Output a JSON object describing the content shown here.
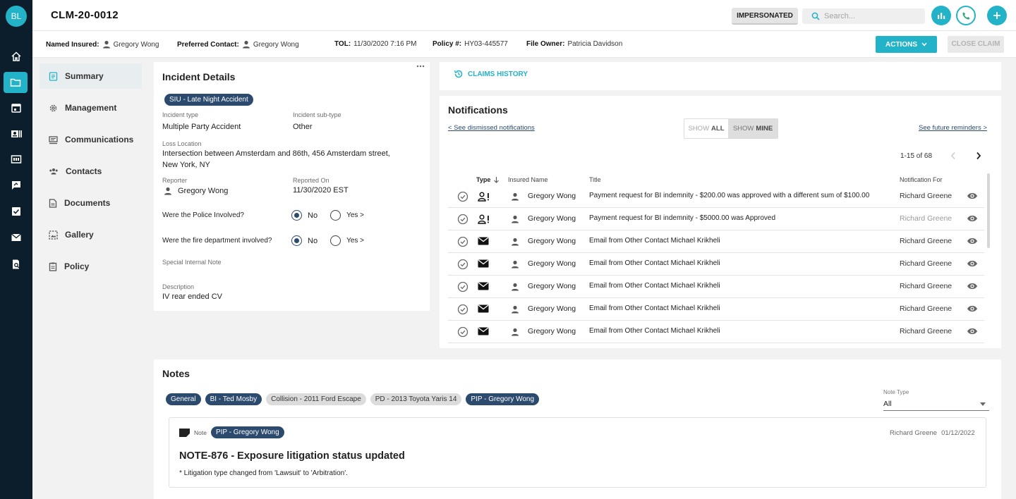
{
  "user": {
    "initials": "BL"
  },
  "rail": {
    "icons": [
      "home-icon",
      "folder-icon",
      "calendar-icon",
      "id-card-icon",
      "numbers-icon",
      "chat-icon",
      "checklist-icon",
      "mail-icon",
      "document-search-icon"
    ]
  },
  "header": {
    "claim_number": "CLM-20-0012",
    "impersonated_label": "IMPERSONATED",
    "search_placeholder": "Search..."
  },
  "info": {
    "named_insured_label": "Named Insured:",
    "named_insured": "Gregory Wong",
    "preferred_contact_label": "Preferred Contact:",
    "preferred_contact": "Gregory Wong",
    "tol_label": "TOL:",
    "tol": "11/30/2020 7:16 PM",
    "policy_label": "Policy #:",
    "policy": "HY03-445577",
    "file_owner_label": "File Owner:",
    "file_owner": "Patricia Davidson",
    "actions_label": "ACTIONS",
    "close_claim_label": "CLOSE CLAIM"
  },
  "sidenav": [
    {
      "label": "Summary",
      "icon": "summary-icon"
    },
    {
      "label": "Management",
      "icon": "gear-icon"
    },
    {
      "label": "Communications",
      "icon": "communications-icon"
    },
    {
      "label": "Contacts",
      "icon": "contacts-icon"
    },
    {
      "label": "Documents",
      "icon": "document-icon"
    },
    {
      "label": "Gallery",
      "icon": "gallery-icon"
    },
    {
      "label": "Policy",
      "icon": "policy-icon"
    }
  ],
  "incident": {
    "title": "Incident Details",
    "tag": "SIU - Late Night Accident",
    "type_label": "Incident type",
    "type": "Multiple Party Accident",
    "subtype_label": "Incident sub-type",
    "subtype": "Other",
    "loss_location_label": "Loss Location",
    "loss_location_line1": "Intersection between Amsterdam and 86th, 456 Amsterdam street,",
    "loss_location_line2": "New York, NY",
    "reporter_label": "Reporter",
    "reporter": "Gregory Wong",
    "reported_on_label": "Reported On",
    "reported_on": "11/30/2020 EST",
    "police_q": "Were the Police Involved?",
    "fire_q": "Were the fire department involved?",
    "no_label": "No",
    "yes_label": "Yes >",
    "special_note_label": "Special Internal Note",
    "description_label": "Description",
    "description": "IV rear ended CV"
  },
  "claims_history_label": "CLAIMS HISTORY",
  "notifications": {
    "title": "Notifications",
    "dismissed_link": "< See dismissed notifications",
    "show_label": "SHOW",
    "all_label": "ALL",
    "mine_label": "MINE",
    "future_link": "See future reminders >",
    "pagination": "1-15 of 68",
    "col_type": "Type",
    "col_insured": "Insured Name",
    "col_title": "Title",
    "col_for": "Notification For",
    "rows": [
      {
        "type_icon": "person-alert-icon",
        "insured": "Gregory Wong",
        "title": "Payment request for BI indemnity - $200.00 was approved with a different sum of $100.00",
        "for": "Richard Greene",
        "faded": false
      },
      {
        "type_icon": "person-alert-icon",
        "insured": "Gregory Wong",
        "title": "Payment request for BI indemnity - $5000.00 was Approved",
        "for": "Richard Greene",
        "faded": true
      },
      {
        "type_icon": "envelope-icon",
        "insured": "Gregory Wong",
        "title": "Email from Other Contact Michael Krikheli",
        "for": "Richard Greene",
        "faded": false
      },
      {
        "type_icon": "envelope-icon",
        "insured": "Gregory Wong",
        "title": "Email from Other Contact Michael Krikheli",
        "for": "Richard Greene",
        "faded": false
      },
      {
        "type_icon": "envelope-icon",
        "insured": "Gregory Wong",
        "title": "Email from Other Contact Michael Krikheli",
        "for": "Richard Greene",
        "faded": false
      },
      {
        "type_icon": "envelope-icon",
        "insured": "Gregory Wong",
        "title": "Email from Other Contact Michael Krikheli",
        "for": "Richard Greene",
        "faded": false
      },
      {
        "type_icon": "envelope-icon",
        "insured": "Gregory Wong",
        "title": "Email from Other Contact Michael Krikheli",
        "for": "Richard Greene",
        "faded": false
      }
    ]
  },
  "notes": {
    "title": "Notes",
    "filters": [
      {
        "label": "General",
        "style": "dark"
      },
      {
        "label": "BI - Ted Mosby",
        "style": "dark"
      },
      {
        "label": "Collision - 2011 Ford Escape",
        "style": "grey"
      },
      {
        "label": "PD - 2013 Toyota Yaris 14",
        "style": "grey"
      },
      {
        "label": "PIP -  Gregory Wong",
        "style": "dark"
      }
    ],
    "note_type_label": "Note Type",
    "note_type_value": "All",
    "note": {
      "kind_label": "Note",
      "tag": "PIP -  Gregory Wong",
      "author": "Richard Greene",
      "date": "01/12/2022",
      "title": "NOTE-876 - Exposure litigation status updated",
      "body": "* Litigation type changed from 'Lawsuit' to 'Arbitration'."
    }
  },
  "colors": {
    "accent": "#23b3c8",
    "navy": "#2b4a6e",
    "rail": "#0c1e2b",
    "phone": "#23b3c8"
  }
}
